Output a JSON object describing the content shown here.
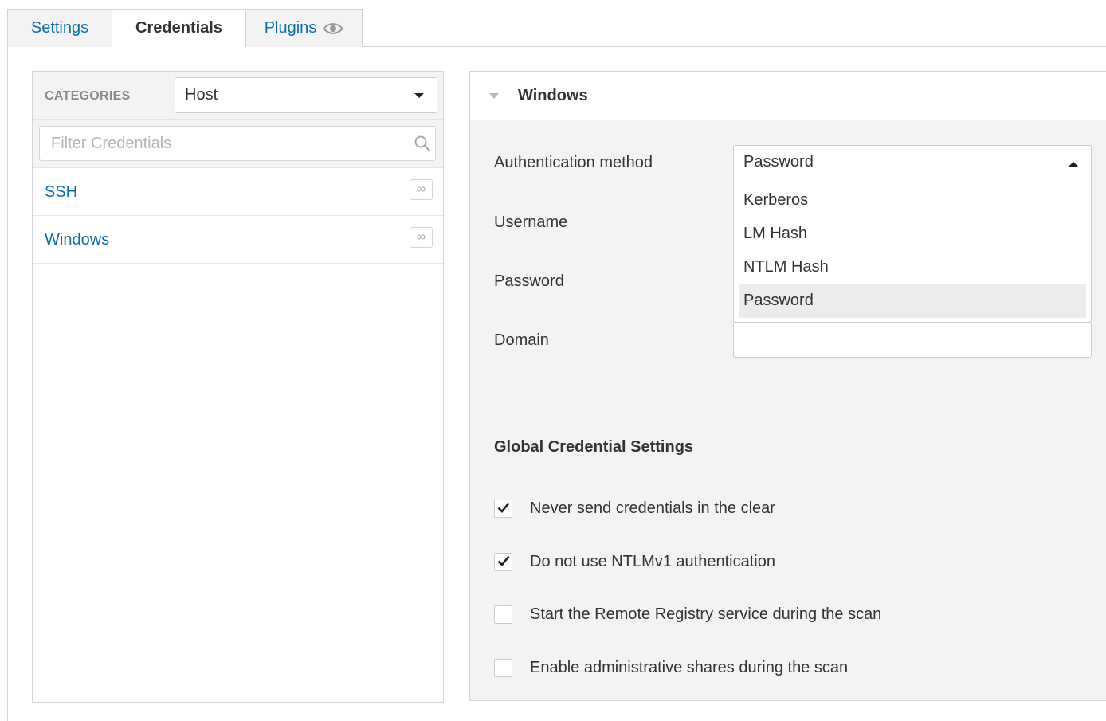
{
  "tabs": [
    {
      "label": "Settings"
    },
    {
      "label": "Credentials"
    },
    {
      "label": "Plugins"
    }
  ],
  "sidebar": {
    "categories_label": "CATEGORIES",
    "category_selected": "Host",
    "filter_placeholder": "Filter Credentials",
    "items": [
      {
        "label": "SSH",
        "badge": "∞"
      },
      {
        "label": "Windows",
        "badge": "∞"
      }
    ]
  },
  "windows": {
    "title": "Windows",
    "labels": {
      "auth_method": "Authentication method",
      "username": "Username",
      "password": "Password",
      "domain": "Domain"
    },
    "auth_selected": "Password",
    "auth_options": [
      "Kerberos",
      "LM Hash",
      "NTLM Hash",
      "Password"
    ],
    "domain_value": ""
  },
  "global_settings": {
    "title": "Global Credential Settings",
    "options": [
      {
        "label": "Never send credentials in the clear",
        "checked": true
      },
      {
        "label": "Do not use NTLMv1 authentication",
        "checked": true
      },
      {
        "label": "Start the Remote Registry service during the scan",
        "checked": false
      },
      {
        "label": "Enable administrative shares during the scan",
        "checked": false
      }
    ]
  }
}
